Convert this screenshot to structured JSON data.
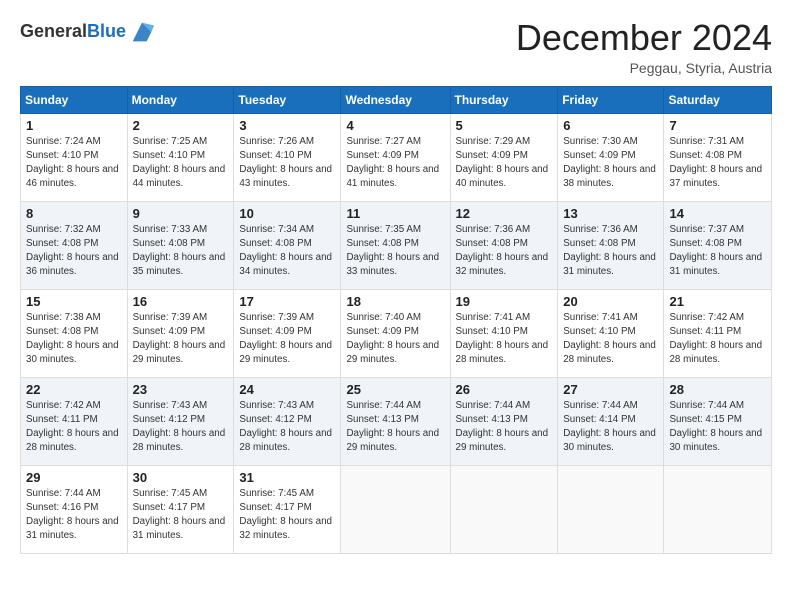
{
  "header": {
    "logo_general": "General",
    "logo_blue": "Blue",
    "month_title": "December 2024",
    "subtitle": "Peggau, Styria, Austria"
  },
  "days_of_week": [
    "Sunday",
    "Monday",
    "Tuesday",
    "Wednesday",
    "Thursday",
    "Friday",
    "Saturday"
  ],
  "weeks": [
    [
      {
        "day": "1",
        "sunrise": "7:24 AM",
        "sunset": "4:10 PM",
        "daylight": "8 hours and 46 minutes."
      },
      {
        "day": "2",
        "sunrise": "7:25 AM",
        "sunset": "4:10 PM",
        "daylight": "8 hours and 44 minutes."
      },
      {
        "day": "3",
        "sunrise": "7:26 AM",
        "sunset": "4:10 PM",
        "daylight": "8 hours and 43 minutes."
      },
      {
        "day": "4",
        "sunrise": "7:27 AM",
        "sunset": "4:09 PM",
        "daylight": "8 hours and 41 minutes."
      },
      {
        "day": "5",
        "sunrise": "7:29 AM",
        "sunset": "4:09 PM",
        "daylight": "8 hours and 40 minutes."
      },
      {
        "day": "6",
        "sunrise": "7:30 AM",
        "sunset": "4:09 PM",
        "daylight": "8 hours and 38 minutes."
      },
      {
        "day": "7",
        "sunrise": "7:31 AM",
        "sunset": "4:08 PM",
        "daylight": "8 hours and 37 minutes."
      }
    ],
    [
      {
        "day": "8",
        "sunrise": "7:32 AM",
        "sunset": "4:08 PM",
        "daylight": "8 hours and 36 minutes."
      },
      {
        "day": "9",
        "sunrise": "7:33 AM",
        "sunset": "4:08 PM",
        "daylight": "8 hours and 35 minutes."
      },
      {
        "day": "10",
        "sunrise": "7:34 AM",
        "sunset": "4:08 PM",
        "daylight": "8 hours and 34 minutes."
      },
      {
        "day": "11",
        "sunrise": "7:35 AM",
        "sunset": "4:08 PM",
        "daylight": "8 hours and 33 minutes."
      },
      {
        "day": "12",
        "sunrise": "7:36 AM",
        "sunset": "4:08 PM",
        "daylight": "8 hours and 32 minutes."
      },
      {
        "day": "13",
        "sunrise": "7:36 AM",
        "sunset": "4:08 PM",
        "daylight": "8 hours and 31 minutes."
      },
      {
        "day": "14",
        "sunrise": "7:37 AM",
        "sunset": "4:08 PM",
        "daylight": "8 hours and 31 minutes."
      }
    ],
    [
      {
        "day": "15",
        "sunrise": "7:38 AM",
        "sunset": "4:08 PM",
        "daylight": "8 hours and 30 minutes."
      },
      {
        "day": "16",
        "sunrise": "7:39 AM",
        "sunset": "4:09 PM",
        "daylight": "8 hours and 29 minutes."
      },
      {
        "day": "17",
        "sunrise": "7:39 AM",
        "sunset": "4:09 PM",
        "daylight": "8 hours and 29 minutes."
      },
      {
        "day": "18",
        "sunrise": "7:40 AM",
        "sunset": "4:09 PM",
        "daylight": "8 hours and 29 minutes."
      },
      {
        "day": "19",
        "sunrise": "7:41 AM",
        "sunset": "4:10 PM",
        "daylight": "8 hours and 28 minutes."
      },
      {
        "day": "20",
        "sunrise": "7:41 AM",
        "sunset": "4:10 PM",
        "daylight": "8 hours and 28 minutes."
      },
      {
        "day": "21",
        "sunrise": "7:42 AM",
        "sunset": "4:11 PM",
        "daylight": "8 hours and 28 minutes."
      }
    ],
    [
      {
        "day": "22",
        "sunrise": "7:42 AM",
        "sunset": "4:11 PM",
        "daylight": "8 hours and 28 minutes."
      },
      {
        "day": "23",
        "sunrise": "7:43 AM",
        "sunset": "4:12 PM",
        "daylight": "8 hours and 28 minutes."
      },
      {
        "day": "24",
        "sunrise": "7:43 AM",
        "sunset": "4:12 PM",
        "daylight": "8 hours and 28 minutes."
      },
      {
        "day": "25",
        "sunrise": "7:44 AM",
        "sunset": "4:13 PM",
        "daylight": "8 hours and 29 minutes."
      },
      {
        "day": "26",
        "sunrise": "7:44 AM",
        "sunset": "4:13 PM",
        "daylight": "8 hours and 29 minutes."
      },
      {
        "day": "27",
        "sunrise": "7:44 AM",
        "sunset": "4:14 PM",
        "daylight": "8 hours and 30 minutes."
      },
      {
        "day": "28",
        "sunrise": "7:44 AM",
        "sunset": "4:15 PM",
        "daylight": "8 hours and 30 minutes."
      }
    ],
    [
      {
        "day": "29",
        "sunrise": "7:44 AM",
        "sunset": "4:16 PM",
        "daylight": "8 hours and 31 minutes."
      },
      {
        "day": "30",
        "sunrise": "7:45 AM",
        "sunset": "4:17 PM",
        "daylight": "8 hours and 31 minutes."
      },
      {
        "day": "31",
        "sunrise": "7:45 AM",
        "sunset": "4:17 PM",
        "daylight": "8 hours and 32 minutes."
      },
      null,
      null,
      null,
      null
    ]
  ],
  "labels": {
    "sunrise": "Sunrise:",
    "sunset": "Sunset:",
    "daylight": "Daylight:"
  }
}
